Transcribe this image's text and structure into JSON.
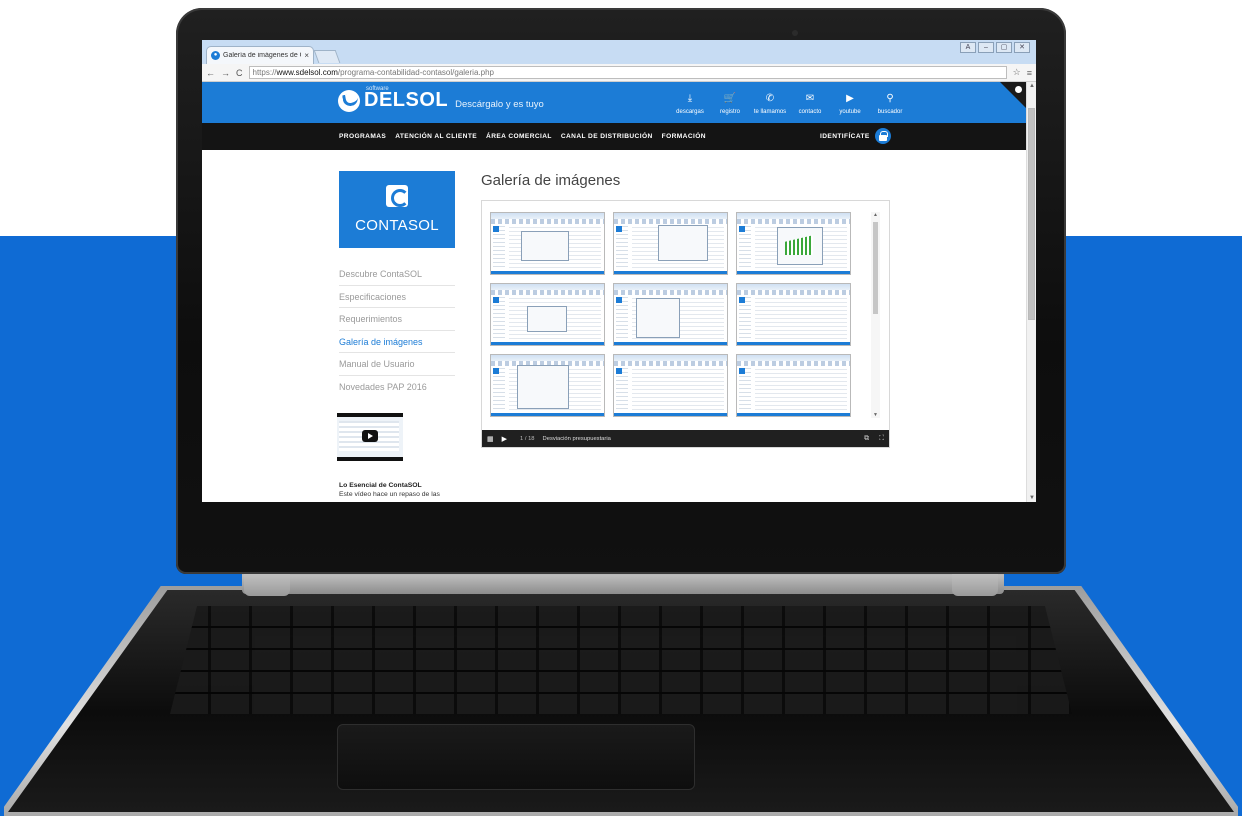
{
  "browser": {
    "tab_title": "Galería de imágenes de C",
    "tab_close": "×",
    "url_scheme": "https://",
    "url_host": "www.sdelsol.com",
    "url_path": "/programa-contabilidad-contasol/galeria.php",
    "nav_back": "←",
    "nav_forward": "→",
    "nav_reload": "C",
    "star": "☆",
    "menu": "≡",
    "window_buttons": [
      "A",
      "–",
      "▢",
      "✕"
    ]
  },
  "header": {
    "logo_small": "software",
    "logo_brand": "DELSOL",
    "tagline": "Descárgalo y es tuyo",
    "icons": [
      {
        "label": "descargas",
        "glyph": "⤓",
        "icon": "download-icon"
      },
      {
        "label": "registro",
        "glyph": "🛒",
        "icon": "cart-icon"
      },
      {
        "label": "te llamamos",
        "glyph": "✆",
        "icon": "phone-icon"
      },
      {
        "label": "contacto",
        "glyph": "✉",
        "icon": "mail-icon"
      },
      {
        "label": "youtube",
        "glyph": "▶",
        "icon": "youtube-icon"
      },
      {
        "label": "buscador",
        "glyph": "⚲",
        "icon": "search-icon"
      }
    ]
  },
  "nav": {
    "items": [
      "PROGRAMAS",
      "ATENCIÓN AL CLIENTE",
      "ÁREA COMERCIAL",
      "CANAL DE DISTRIBUCIÓN",
      "FORMACIÓN"
    ],
    "login": "IDENTIFÍCATE"
  },
  "sidebar": {
    "product_name": "CONTASOL",
    "links": [
      "Descubre ContaSOL",
      "Especificaciones",
      "Requerimientos",
      "Galería de imágenes",
      "Manual de Usuario",
      "Novedades PAP 2016"
    ],
    "active_index": 3,
    "video_title": "Lo Esencial de ContaSOL",
    "video_desc": "Este vídeo hace un repaso de las"
  },
  "gallery": {
    "title": "Galería de imágenes",
    "counter": "1 / 18",
    "caption": "Desviación presupuestaria",
    "thumbnail_count": 9
  },
  "colors": {
    "brand_blue": "#1c7cd6",
    "nav_black": "#141414",
    "backdrop_blue": "#0f6bd4"
  }
}
